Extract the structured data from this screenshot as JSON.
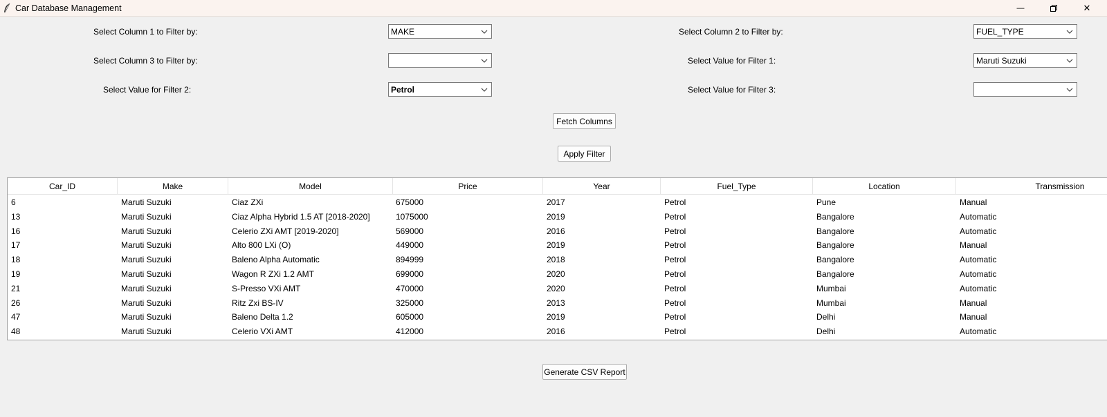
{
  "window": {
    "title": "Car Database Management",
    "minimize_glyph": "—",
    "close_glyph": "✕"
  },
  "filters": {
    "col1_label": "Select Column 1 to Filter by:",
    "col1_value": "MAKE",
    "col2_label": "Select Column 2 to Filter by:",
    "col2_value": "FUEL_TYPE",
    "col3_label": "Select Column 3 to Filter by:",
    "col3_value": "",
    "val1_label": "Select Value for Filter 1:",
    "val1_value": "Maruti Suzuki",
    "val2_label": "Select Value for Filter 2:",
    "val2_value": "Petrol",
    "val3_label": "Select Value for Filter 3:",
    "val3_value": ""
  },
  "buttons": {
    "fetch_columns": "Fetch Columns",
    "apply_filter": "Apply Filter",
    "generate_csv": "Generate CSV Report"
  },
  "table": {
    "columns": [
      "Car_ID",
      "Make",
      "Model",
      "Price",
      "Year",
      "Fuel_Type",
      "Location",
      "Transmission"
    ],
    "rows": [
      [
        "6",
        "Maruti Suzuki",
        "Ciaz ZXi",
        "675000",
        "2017",
        "Petrol",
        "Pune",
        "Manual"
      ],
      [
        "13",
        "Maruti Suzuki",
        "Ciaz Alpha Hybrid 1.5 AT [2018-2020]",
        "1075000",
        "2019",
        "Petrol",
        "Bangalore",
        "Automatic"
      ],
      [
        "16",
        "Maruti Suzuki",
        "Celerio ZXi AMT [2019-2020]",
        "569000",
        "2016",
        "Petrol",
        "Bangalore",
        "Automatic"
      ],
      [
        "17",
        "Maruti Suzuki",
        "Alto 800 LXi (O)",
        "449000",
        "2019",
        "Petrol",
        "Bangalore",
        "Manual"
      ],
      [
        "18",
        "Maruti Suzuki",
        "Baleno Alpha Automatic",
        "894999",
        "2018",
        "Petrol",
        "Bangalore",
        "Automatic"
      ],
      [
        "19",
        "Maruti Suzuki",
        "Wagon R ZXi 1.2 AMT",
        "699000",
        "2020",
        "Petrol",
        "Bangalore",
        "Automatic"
      ],
      [
        "21",
        "Maruti Suzuki",
        "S-Presso VXi AMT",
        "470000",
        "2020",
        "Petrol",
        "Mumbai",
        "Automatic"
      ],
      [
        "26",
        "Maruti Suzuki",
        "Ritz Zxi BS-IV",
        "325000",
        "2013",
        "Petrol",
        "Mumbai",
        "Manual"
      ],
      [
        "47",
        "Maruti Suzuki",
        "Baleno Delta 1.2",
        "605000",
        "2019",
        "Petrol",
        "Delhi",
        "Manual"
      ],
      [
        "48",
        "Maruti Suzuki",
        "Celerio VXi AMT",
        "412000",
        "2016",
        "Petrol",
        "Delhi",
        "Automatic"
      ]
    ]
  }
}
